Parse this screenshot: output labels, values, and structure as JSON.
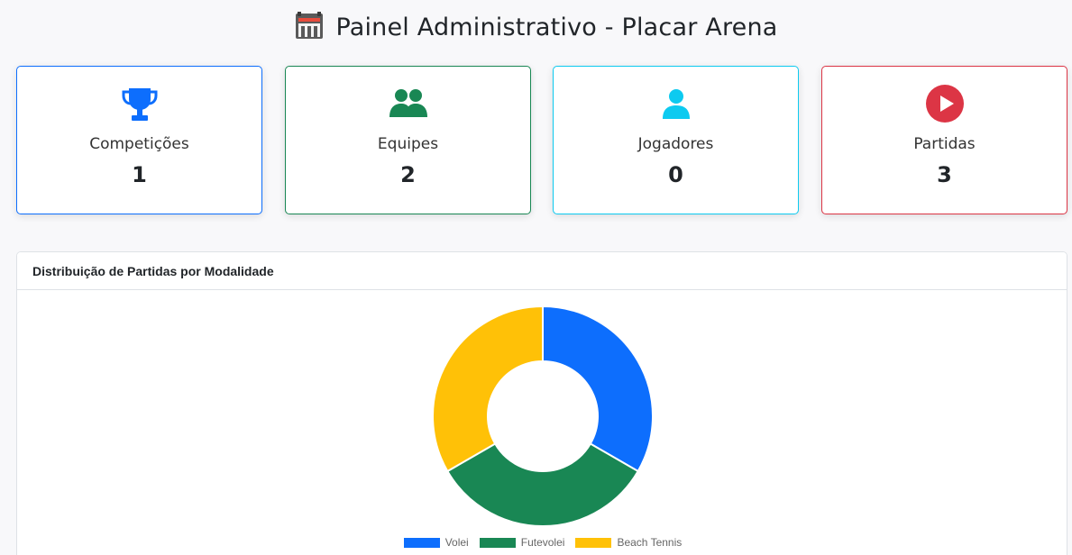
{
  "header": {
    "title": "Painel Administrativo - Placar Arena",
    "icon": "stadium-icon"
  },
  "stats": [
    {
      "label": "Competições",
      "value": "1",
      "icon": "trophy-icon",
      "color": "#0d6efd"
    },
    {
      "label": "Equipes",
      "value": "2",
      "icon": "users-icon",
      "color": "#198754"
    },
    {
      "label": "Jogadores",
      "value": "0",
      "icon": "user-icon",
      "color": "#0dcaf0"
    },
    {
      "label": "Partidas",
      "value": "3",
      "icon": "play-circle-icon",
      "color": "#dc3545"
    }
  ],
  "chart_card": {
    "title": "Distribuição de Partidas por Modalidade"
  },
  "chart_data": {
    "type": "pie",
    "categories": [
      "Volei",
      "Futevolei",
      "Beach Tennis"
    ],
    "values": [
      1,
      1,
      1
    ],
    "colors": [
      "#0d6efd",
      "#198754",
      "#ffc107"
    ],
    "donut": true,
    "legend": "bottom",
    "title": ""
  }
}
